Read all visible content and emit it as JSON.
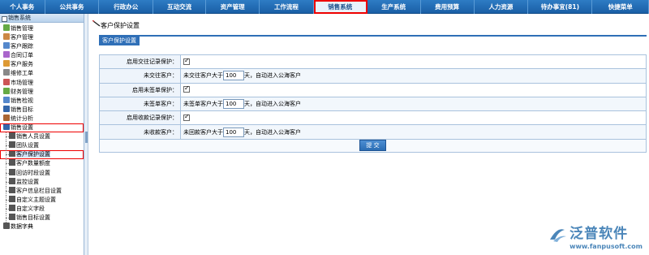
{
  "topnav": [
    {
      "label": "个人事务"
    },
    {
      "label": "公共事务"
    },
    {
      "label": "行政办公"
    },
    {
      "label": "互动交流"
    },
    {
      "label": "资产管理"
    },
    {
      "label": "工作流程"
    },
    {
      "label": "销售系统",
      "active": true
    },
    {
      "label": "生产系统"
    },
    {
      "label": "费用预算"
    },
    {
      "label": "人力资源"
    },
    {
      "label": "待办事宜(81)"
    },
    {
      "label": "快捷菜单"
    }
  ],
  "sidebar": {
    "title": "销售系统",
    "items": [
      {
        "label": "销售管理"
      },
      {
        "label": "客户管理"
      },
      {
        "label": "客户跟踪"
      },
      {
        "label": "合同订单"
      },
      {
        "label": "客户服务"
      },
      {
        "label": "维修工单"
      },
      {
        "label": "市场管理"
      },
      {
        "label": "财务管理"
      },
      {
        "label": "销售检视"
      },
      {
        "label": "销售目标"
      },
      {
        "label": "统计分析"
      },
      {
        "label": "销售设置"
      },
      {
        "label": "销售人员设置"
      },
      {
        "label": "团队设置"
      },
      {
        "label": "客户保护设置"
      },
      {
        "label": "客户数量额度"
      },
      {
        "label": "回访时段设置"
      },
      {
        "label": "监控设置"
      },
      {
        "label": "客户信息栏目设置"
      },
      {
        "label": "自定义主题设置"
      },
      {
        "label": "自定义字段"
      },
      {
        "label": "销售目标设置"
      },
      {
        "label": "数据字典"
      }
    ]
  },
  "main": {
    "title": "客户保护设置",
    "tab": "客户保护设置",
    "rows": [
      {
        "label": "启用交往记录保护：",
        "type": "checkbox",
        "checked": true
      },
      {
        "label": "未交往客户：",
        "type": "days",
        "prefix": "未交往客户大于",
        "value": "100",
        "suffix": "天，自动进入公海客户"
      },
      {
        "label": "启用未签单保护：",
        "type": "checkbox",
        "checked": true
      },
      {
        "label": "未签单客户：",
        "type": "days",
        "prefix": "未签单客户大于",
        "value": "100",
        "suffix": "天，自动进入公海客户"
      },
      {
        "label": "启用收款记录保护：",
        "type": "checkbox",
        "checked": true
      },
      {
        "label": "未收款客户：",
        "type": "days",
        "prefix": "未回款客户大于",
        "value": "100",
        "suffix": "天，自动进入公海客户"
      }
    ],
    "submit_label": "提 交"
  },
  "watermark": {
    "name": "泛普软件",
    "url": "www.fanpusoft.com"
  },
  "colors": {
    "nav_bg": "#1f66ad",
    "accent": "#2f6fb7",
    "highlight": "#e00000",
    "watermark": "#4b86b9"
  }
}
